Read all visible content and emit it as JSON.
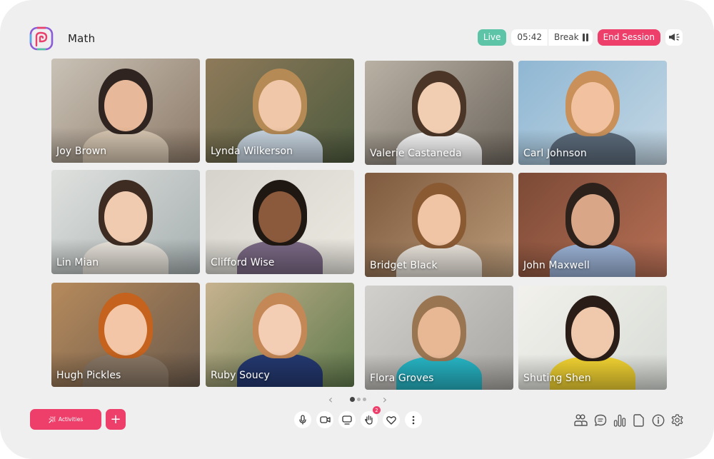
{
  "app": {
    "title": "Math",
    "logo": "app-logo-icon"
  },
  "header": {
    "live_label": "Live",
    "timer": "05:42",
    "break_label": "Break",
    "end_session_label": "End Session",
    "announce_icon": "megaphone-icon"
  },
  "colors": {
    "accent": "#ee3f6a",
    "live": "#5ec4a8",
    "background": "#efefef"
  },
  "participants": [
    {
      "name": "Joy Brown"
    },
    {
      "name": "Lynda Wilkerson"
    },
    {
      "name": "Valerie Castaneda"
    },
    {
      "name": "Carl Johnson"
    },
    {
      "name": "Lin Mian"
    },
    {
      "name": "Clifford Wise"
    },
    {
      "name": "Bridget Black"
    },
    {
      "name": "John Maxwell"
    },
    {
      "name": "Hugh Pickles"
    },
    {
      "name": "Ruby Soucy"
    },
    {
      "name": "Flora Groves"
    },
    {
      "name": "Shuting Shen"
    }
  ],
  "pagination": {
    "current_page": 1,
    "total_pages": 3,
    "prev": "‹",
    "next": "›"
  },
  "footer": {
    "activities_label": "Activities",
    "add_label": "+",
    "media_buttons": [
      {
        "icon": "microphone-icon"
      },
      {
        "icon": "camera-icon"
      },
      {
        "icon": "screen-share-icon"
      },
      {
        "icon": "raise-hand-icon",
        "count": "2"
      },
      {
        "icon": "heart-icon"
      },
      {
        "icon": "more-icon"
      }
    ],
    "tools": [
      {
        "icon": "participants-icon"
      },
      {
        "icon": "chat-icon"
      },
      {
        "icon": "stats-icon"
      },
      {
        "icon": "document-icon"
      },
      {
        "icon": "info-icon"
      },
      {
        "icon": "settings-icon"
      }
    ]
  }
}
